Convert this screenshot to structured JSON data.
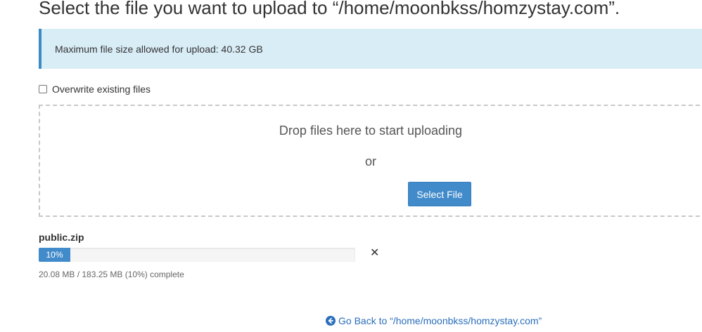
{
  "page_title": "Select the file you want to upload to “/home/moonbkss/homzystay.com”.",
  "alert": {
    "message": "Maximum file size allowed for upload: 40.32 GB"
  },
  "overwrite": {
    "label": "Overwrite existing files",
    "checked": false
  },
  "dropzone": {
    "drop_text": "Drop files here to start uploading",
    "or_text": "or",
    "select_button": "Select File"
  },
  "upload": {
    "file_name": "public.zip",
    "progress_percent": 10,
    "progress_label": "10%",
    "status": "20.08 MB / 183.25 MB (10%) complete",
    "cancel_icon": "close-icon"
  },
  "back_link": {
    "label": "Go Back to “/home/moonbkss/homzystay.com”",
    "icon": "arrow-circle-left-icon"
  },
  "colors": {
    "primary": "#428bca",
    "alert_bg": "#d9edf7",
    "alert_border": "#3a8bc3",
    "link": "#2a6ebb"
  }
}
